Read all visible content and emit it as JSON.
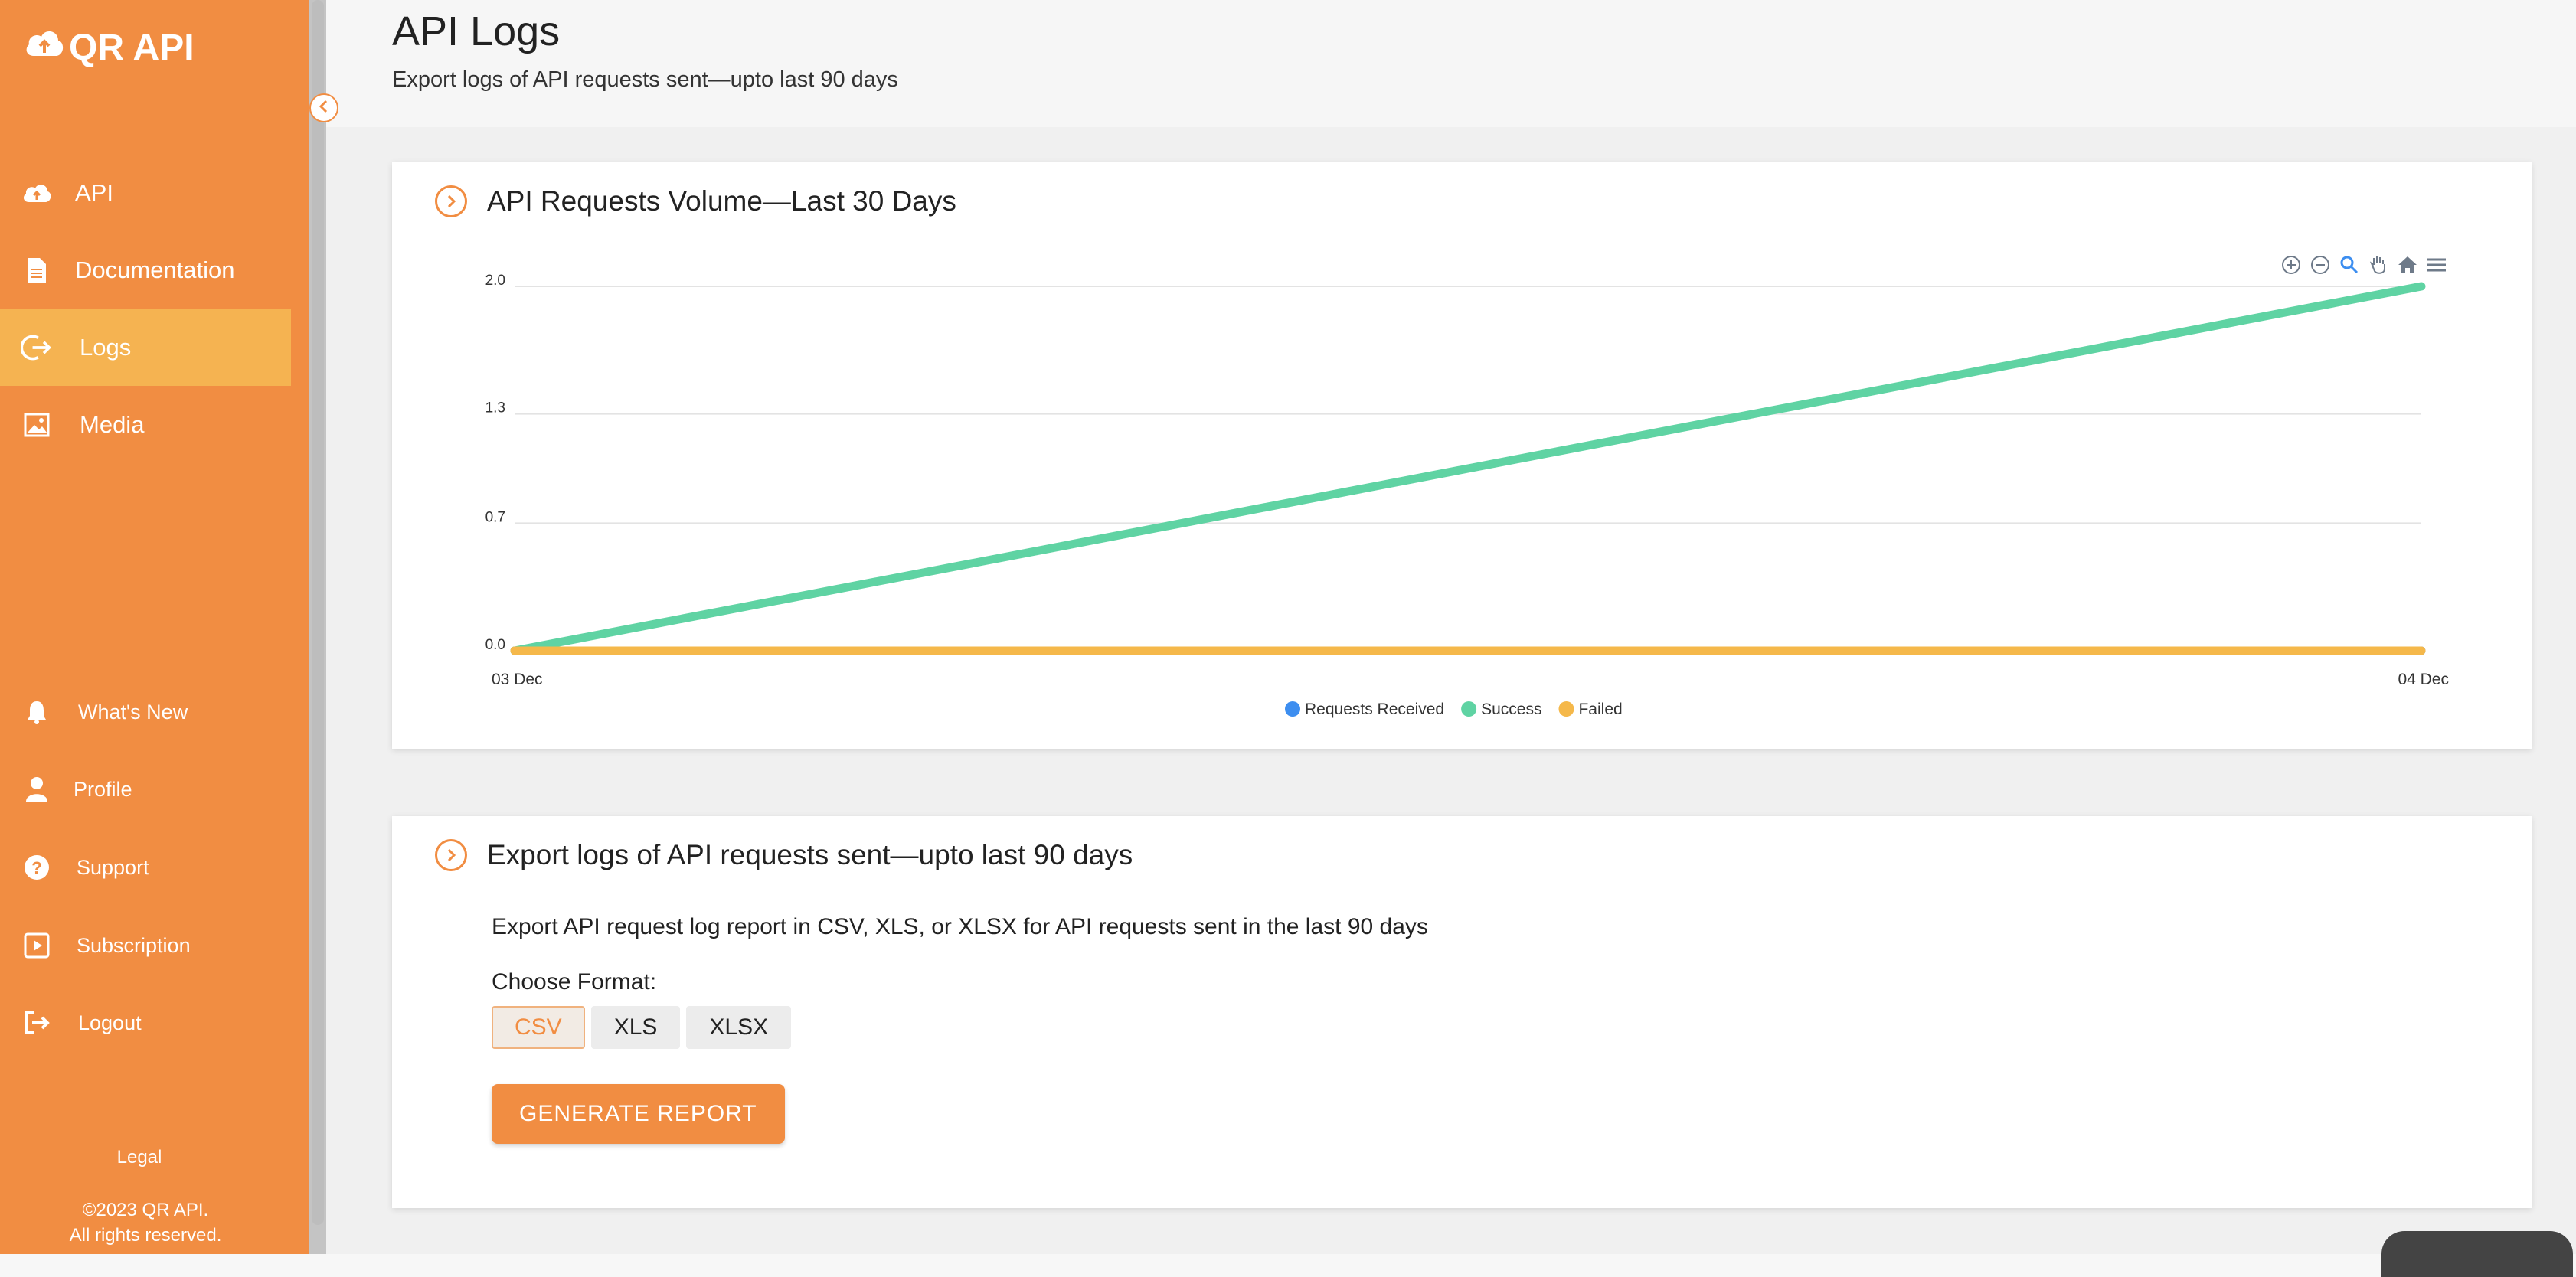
{
  "app": {
    "logo_text": "QR API",
    "accent_color": "#f18d42",
    "active_color": "#f5b351"
  },
  "sidebar": {
    "items": [
      {
        "label": "API",
        "icon": "cloud-upload-icon"
      },
      {
        "label": "Documentation",
        "icon": "document-icon"
      },
      {
        "label": "Logs",
        "icon": "sign-out-arrow-icon",
        "active": true
      },
      {
        "label": "Media",
        "icon": "image-icon"
      }
    ],
    "bottom_items": [
      {
        "label": "What's New",
        "icon": "bell-icon"
      },
      {
        "label": "Profile",
        "icon": "user-icon"
      },
      {
        "label": "Support",
        "icon": "question-circle-icon"
      },
      {
        "label": "Subscription",
        "icon": "play-square-icon"
      },
      {
        "label": "Logout",
        "icon": "logout-icon"
      }
    ],
    "legal": "Legal",
    "copyright_line1": "©2023  QR  API.",
    "copyright_line2": "All  rights  reserved."
  },
  "header": {
    "title": "API Logs",
    "subtitle": "Export logs of API requests sent—upto last 90 days"
  },
  "volume_card": {
    "title": "API Requests Volume—Last 30 Days",
    "toolbar": [
      "zoom-in-icon",
      "zoom-out-icon",
      "magnify-icon",
      "pan-hand-icon",
      "home-icon",
      "menu-icon"
    ]
  },
  "chart_data": {
    "type": "line",
    "title": "",
    "xlabel": "",
    "ylabel": "",
    "x": [
      "03 Dec",
      "04 Dec"
    ],
    "y_ticks": [
      "0.0",
      "0.7",
      "1.3",
      "2.0"
    ],
    "ylim": [
      0,
      2
    ],
    "grid": true,
    "legend_position": "bottom",
    "series": [
      {
        "name": "Requests Received",
        "color": "#3d8ef0",
        "values": [
          0,
          0
        ]
      },
      {
        "name": "Success",
        "color": "#5fd3a3",
        "values": [
          0,
          2
        ]
      },
      {
        "name": "Failed",
        "color": "#f5b84a",
        "values": [
          0,
          0
        ]
      }
    ]
  },
  "export_card": {
    "title": "Export logs of API requests sent—upto last 90 days",
    "description": "Export API request log report in CSV, XLS, or XLSX for API requests sent in the last 90 days",
    "choose_label": "Choose Format:",
    "formats": [
      "CSV",
      "XLS",
      "XLSX"
    ],
    "selected_format": "CSV",
    "generate_label": "GENERATE REPORT"
  }
}
